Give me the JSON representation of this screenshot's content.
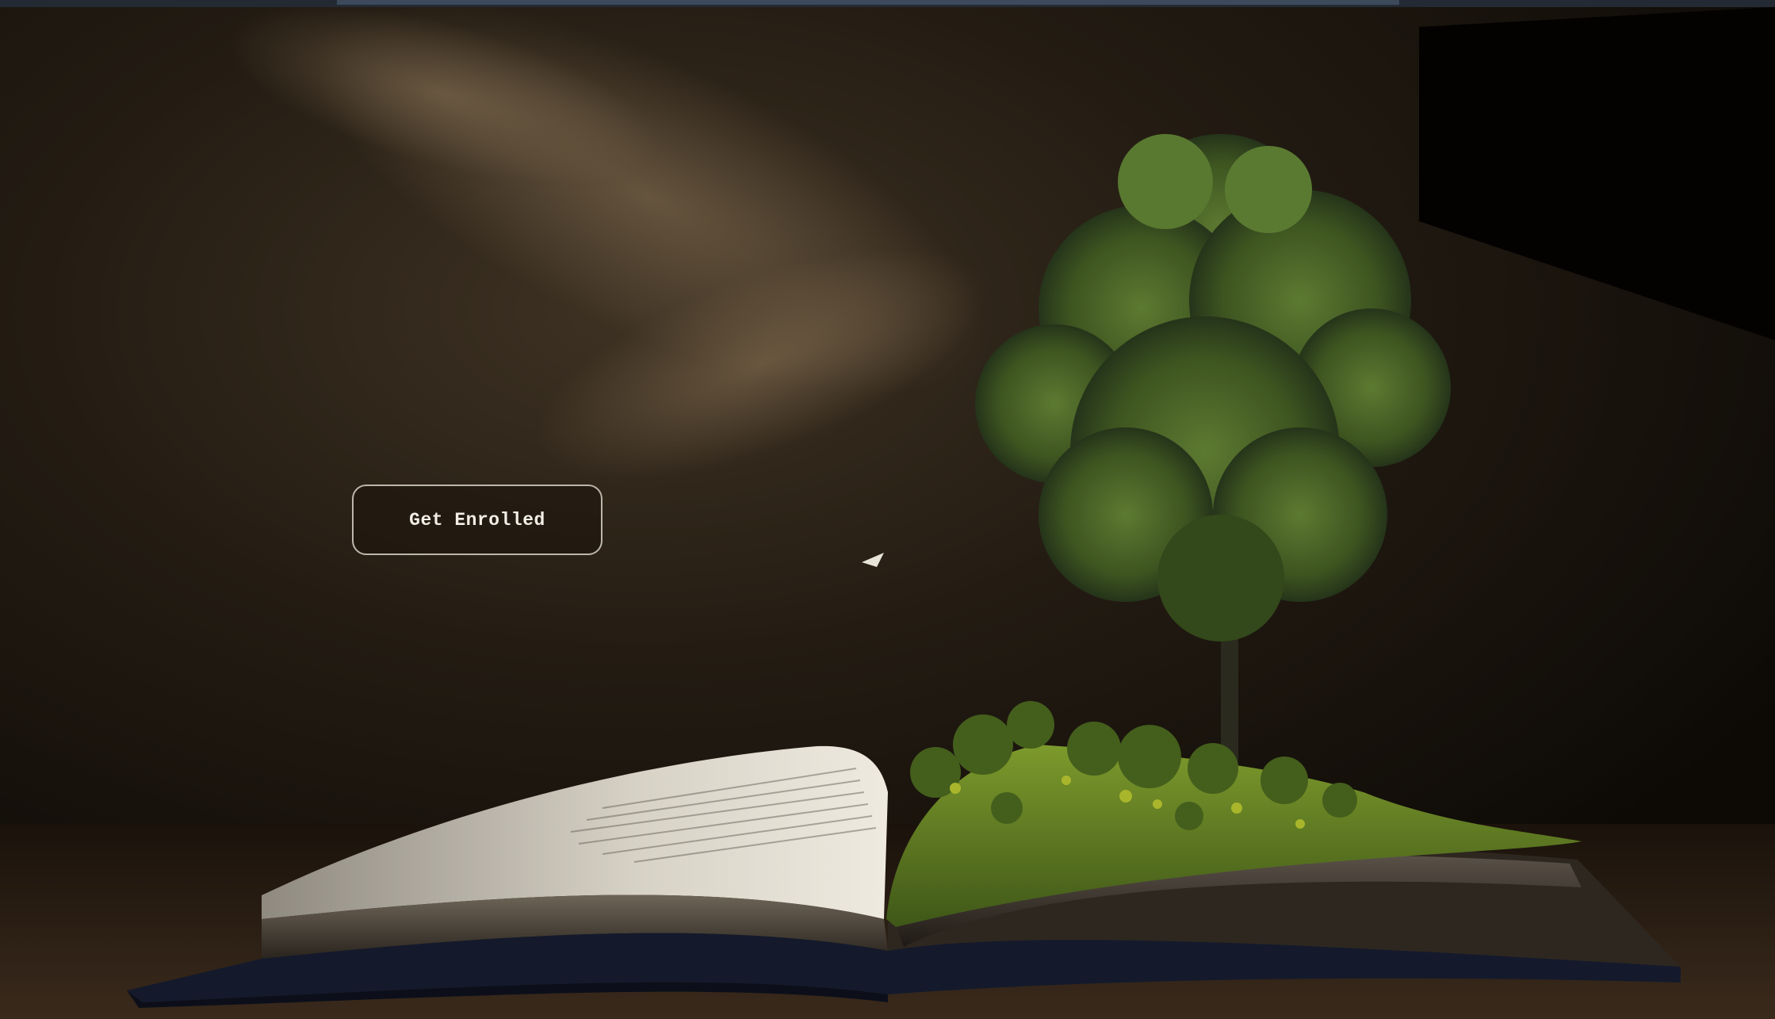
{
  "hero": {
    "cta_label": "Get Enrolled"
  },
  "colors": {
    "background": "#0b0804",
    "top_bar": "#232a33",
    "button_border": "#bdb6ab",
    "button_text": "#f3eee6",
    "foliage": "#4f6a2b",
    "grass": "#6f8a24"
  },
  "images": {
    "hero_background": "open-book-with-tree-illustration"
  }
}
